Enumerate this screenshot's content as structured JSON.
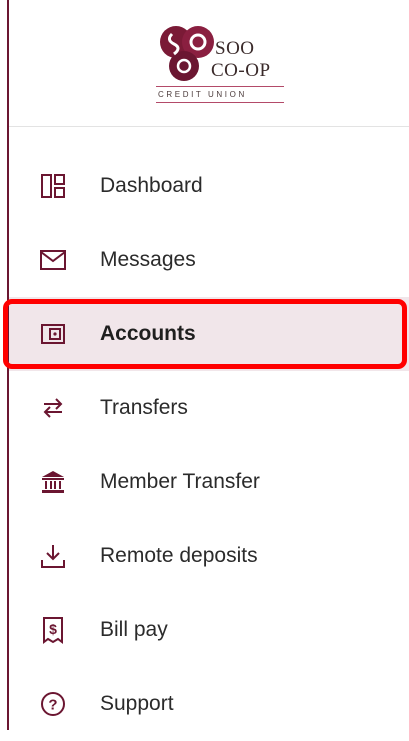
{
  "brand": {
    "line1": "SOO",
    "line2": "CO-OP",
    "tagline": "CREDIT UNION",
    "accent_color": "#6b1631"
  },
  "nav": {
    "items": [
      {
        "label": "Dashboard",
        "icon": "dashboard-icon",
        "active": false
      },
      {
        "label": "Messages",
        "icon": "envelope-icon",
        "active": false
      },
      {
        "label": "Accounts",
        "icon": "wallet-icon",
        "active": true
      },
      {
        "label": "Transfers",
        "icon": "transfer-arrows-icon",
        "active": false
      },
      {
        "label": "Member Transfer",
        "icon": "bank-icon",
        "active": false
      },
      {
        "label": "Remote deposits",
        "icon": "download-tray-icon",
        "active": false
      },
      {
        "label": "Bill pay",
        "icon": "receipt-dollar-icon",
        "active": false
      },
      {
        "label": "Support",
        "icon": "help-circle-icon",
        "active": false
      }
    ],
    "active_bg": "#f1e6ea",
    "highlight_color": "#ff0000"
  }
}
